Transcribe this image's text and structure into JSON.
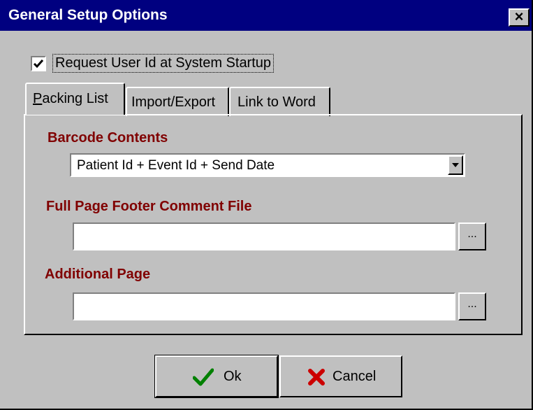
{
  "window": {
    "title": "General Setup Options",
    "close_label": "×"
  },
  "checkbox": {
    "label": "Request User Id at System Startup",
    "checked": true
  },
  "tabs": [
    {
      "label_hotkey": "P",
      "label_rest": "acking List",
      "active": true
    },
    {
      "label": "Import/Export",
      "active": false
    },
    {
      "label": "Link to Word",
      "active": false
    }
  ],
  "packing_list": {
    "barcode_label": "Barcode Contents",
    "barcode_value": "Patient Id + Event Id + Send Date",
    "footer_label": "Full Page Footer Comment File",
    "footer_value": "",
    "additional_label": "Additional Page",
    "additional_value": "",
    "browse_label": "..."
  },
  "buttons": {
    "ok_label": "Ok",
    "cancel_label": "Cancel"
  },
  "colors": {
    "titlebar": "#000080",
    "section_label": "#800000",
    "ok_check": "#008000",
    "cancel_x": "#cc0000"
  },
  "icons": {
    "ok": "green-checkmark-icon",
    "cancel": "red-x-icon",
    "dropdown": "dropdown-arrow-icon"
  }
}
